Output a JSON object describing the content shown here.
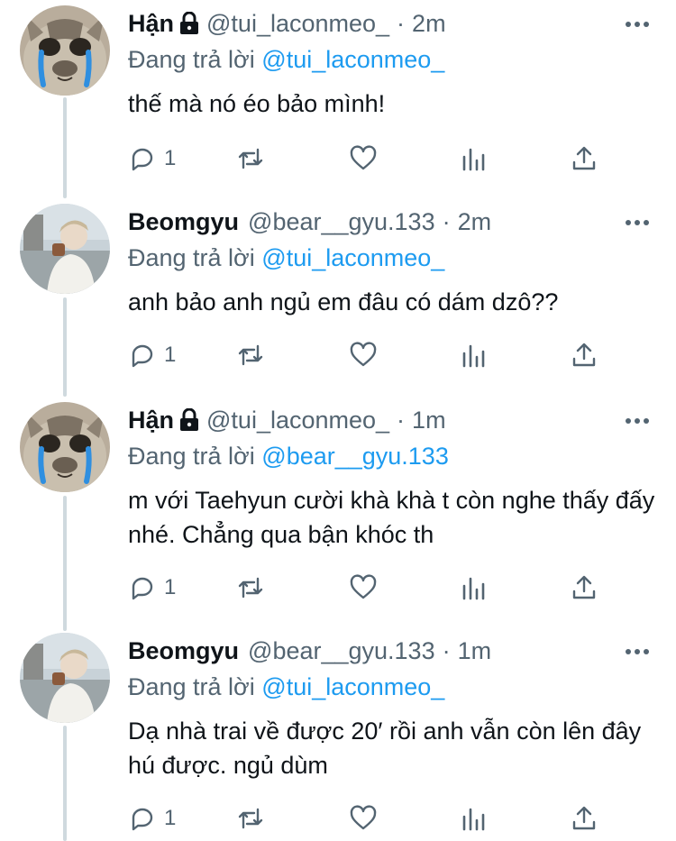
{
  "tweets": [
    {
      "name": "Hận",
      "locked": true,
      "handle": "@tui_laconmeo_",
      "time": "2m",
      "reply_prefix": "Đang trả lời",
      "reply_to": "@tui_laconmeo_",
      "text": "thế mà nó éo bảo mình!",
      "reply_count": "1",
      "avatar": "cat-avatar"
    },
    {
      "name": "Beomgyu",
      "locked": false,
      "handle": "@bear__gyu.133",
      "time": "2m",
      "reply_prefix": "Đang trả lời",
      "reply_to": "@tui_laconmeo_",
      "text": "anh bảo anh ngủ em đâu có dám dzô??",
      "reply_count": "1",
      "avatar": "person-avatar"
    },
    {
      "name": "Hận",
      "locked": true,
      "handle": "@tui_laconmeo_",
      "time": "1m",
      "reply_prefix": "Đang trả lời",
      "reply_to": "@bear__gyu.133",
      "text": "m với Taehyun cười khà khà t còn nghe thấy đấy nhé. Chẳng qua bận khóc th",
      "reply_count": "1",
      "avatar": "cat-avatar"
    },
    {
      "name": "Beomgyu",
      "locked": false,
      "handle": "@bear__gyu.133",
      "time": "1m",
      "reply_prefix": "Đang trả lời",
      "reply_to": "@tui_laconmeo_",
      "text": "Dạ nhà trai về được 20′ rồi anh vẫn còn lên đây hú được. ngủ dùm",
      "reply_count": "1",
      "avatar": "person-avatar"
    }
  ],
  "separator": "·",
  "icons": [
    "lock-icon",
    "more-icon",
    "reply-icon",
    "retweet-icon",
    "like-icon",
    "analytics-icon",
    "share-icon"
  ],
  "colors": {
    "text": "#0f1419",
    "secondary": "#536471",
    "link": "#1d9bf0",
    "thread_line": "#cfd9de"
  }
}
